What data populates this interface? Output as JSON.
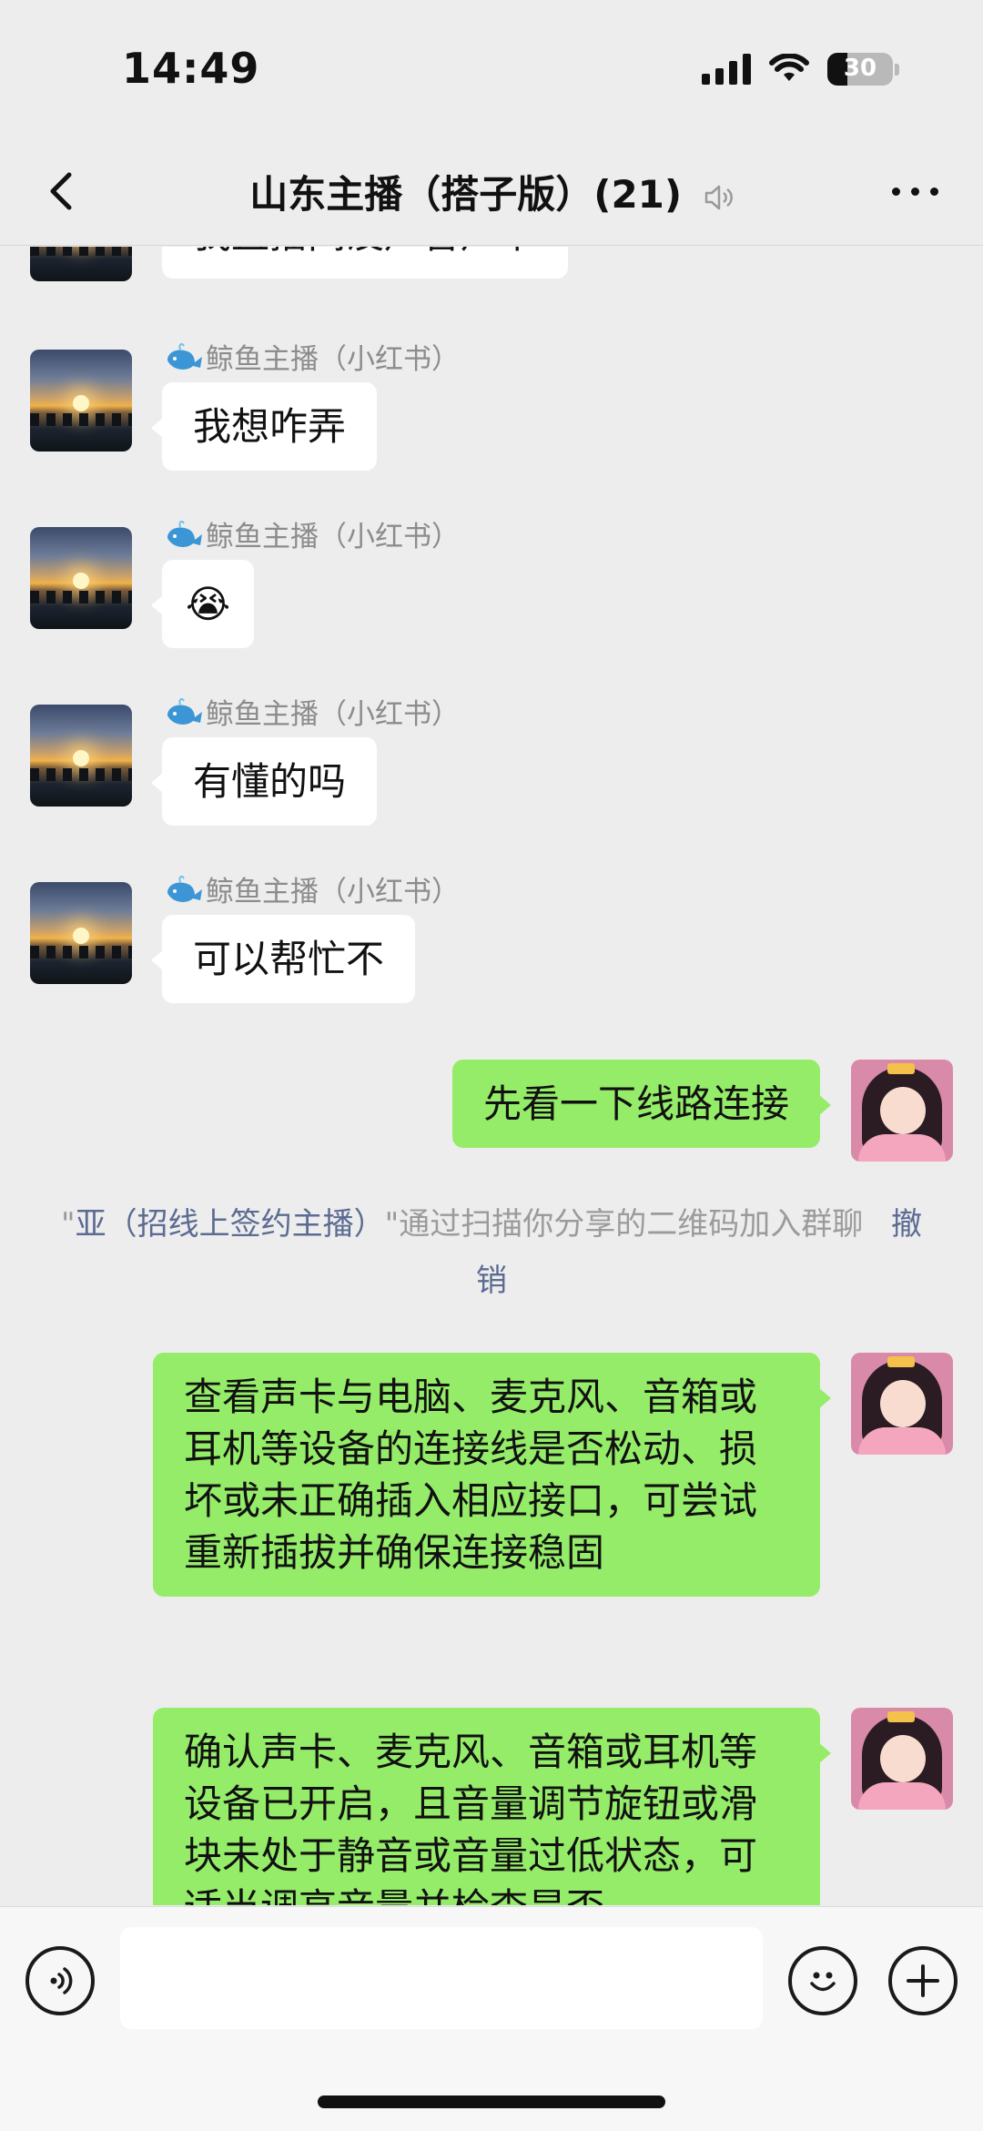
{
  "status_bar": {
    "time": "14:49",
    "battery": "30",
    "battery_level_percent": 30
  },
  "nav": {
    "title": "山东主播（搭子版）(21)",
    "muted": true
  },
  "messages": {
    "partial_message": "我直播间没声音声卡",
    "items": [
      {
        "sender": "鲸鱼主播（小红书）",
        "text": "我想咋弄"
      },
      {
        "sender": "鲸鱼主播（小红书）",
        "text": "😭"
      },
      {
        "sender": "鲸鱼主播（小红书）",
        "text": "有懂的吗"
      },
      {
        "sender": "鲸鱼主播（小红书）",
        "text": "可以帮忙不"
      }
    ],
    "sent_1": "先看一下线路连接",
    "system": {
      "quote_open": "\"",
      "name": "亚（招线上签约主播）",
      "text": "\"通过扫描你分享的二维码加入群聊",
      "undo": "撤销"
    },
    "sent_2": "查看声卡与电脑、麦克风、音箱或耳机等设备的连接线是否松动、损坏或未正确插入相应接口，可尝试重新插拔并确保连接稳固",
    "sent_3": "确认声卡、麦克风、音箱或耳机等设备已开启，且音量调节旋钮或滑块未处于静音或音量过低状态，可适当调高音量并检查是否"
  },
  "input": {
    "value": "",
    "placeholder": ""
  },
  "colors": {
    "sent_bubble": "#95ec69",
    "received_bubble": "#ffffff",
    "background": "#ededed",
    "link": "#5b6b92"
  }
}
